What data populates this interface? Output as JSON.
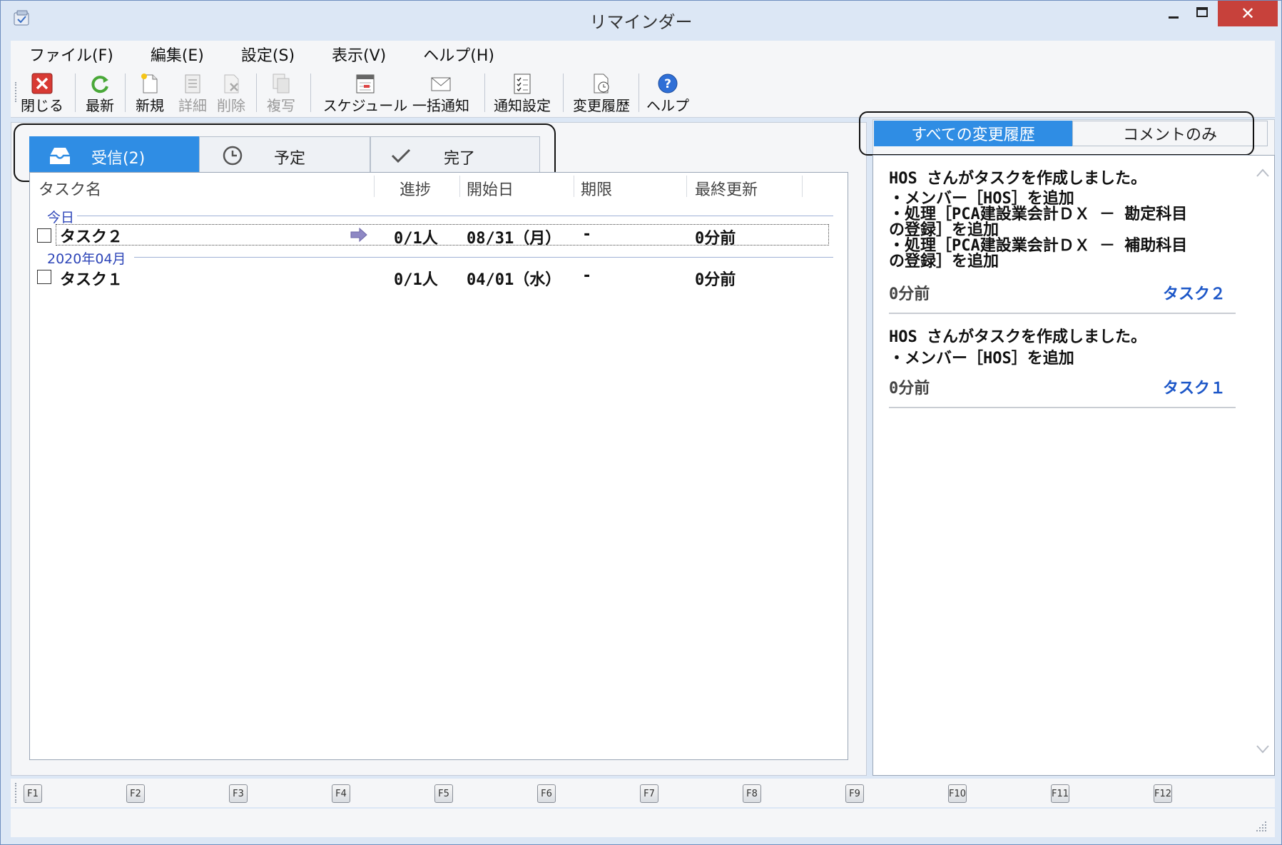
{
  "window": {
    "title": "リマインダー"
  },
  "menu": [
    "ファイル(F)",
    "編集(E)",
    "設定(S)",
    "表示(V)",
    "ヘルプ(H)"
  ],
  "toolbar": {
    "close": "閉じる",
    "refresh": "最新",
    "new": "新規",
    "detail": "詳細",
    "delete": "削除",
    "copy": "複写",
    "schedule": "スケジュール",
    "bulk_notify": "一括通知",
    "notify_settings": "通知設定",
    "history": "変更履歴",
    "help": "ヘルプ"
  },
  "tabs": {
    "inbox": "受信(2)",
    "scheduled": "予定",
    "done": "完了"
  },
  "columns": {
    "task_name": "タスク名",
    "progress": "進捗",
    "start_date": "開始日",
    "deadline": "期限",
    "last_update": "最終更新"
  },
  "groups": [
    {
      "label": "今日"
    },
    {
      "label": "2020年04月"
    }
  ],
  "rows": [
    {
      "name": "タスク２",
      "progress": "0/1人",
      "start": "08/31（月）",
      "deadline": "-",
      "updated": "0分前"
    },
    {
      "name": "タスク１",
      "progress": "0/1人",
      "start": "04/01（水）",
      "deadline": "-",
      "updated": "0分前"
    }
  ],
  "history_tabs": {
    "all": "すべての変更履歴",
    "comments": "コメントのみ"
  },
  "history": [
    {
      "lines": [
        "HOS さんがタスクを作成しました。",
        "・メンバー［HOS］を追加",
        "・処理［PCA建設業会計ＤＸ － 勘定科目",
        "の登録］を追加",
        "・処理［PCA建設業会計ＤＸ － 補助科目",
        "の登録］を追加"
      ],
      "time": "0分前",
      "task": "タスク２"
    },
    {
      "lines": [
        "HOS さんがタスクを作成しました。",
        "・メンバー［HOS］を追加"
      ],
      "time": "0分前",
      "task": "タスク１"
    }
  ],
  "fkeys": [
    "F1",
    "F2",
    "F3",
    "F4",
    "F5",
    "F6",
    "F7",
    "F8",
    "F9",
    "F10",
    "F11",
    "F12"
  ],
  "colors": {
    "accent": "#2f8de4",
    "link": "#1d57c8",
    "group": "#2d45b8",
    "close": "#c7413b"
  }
}
